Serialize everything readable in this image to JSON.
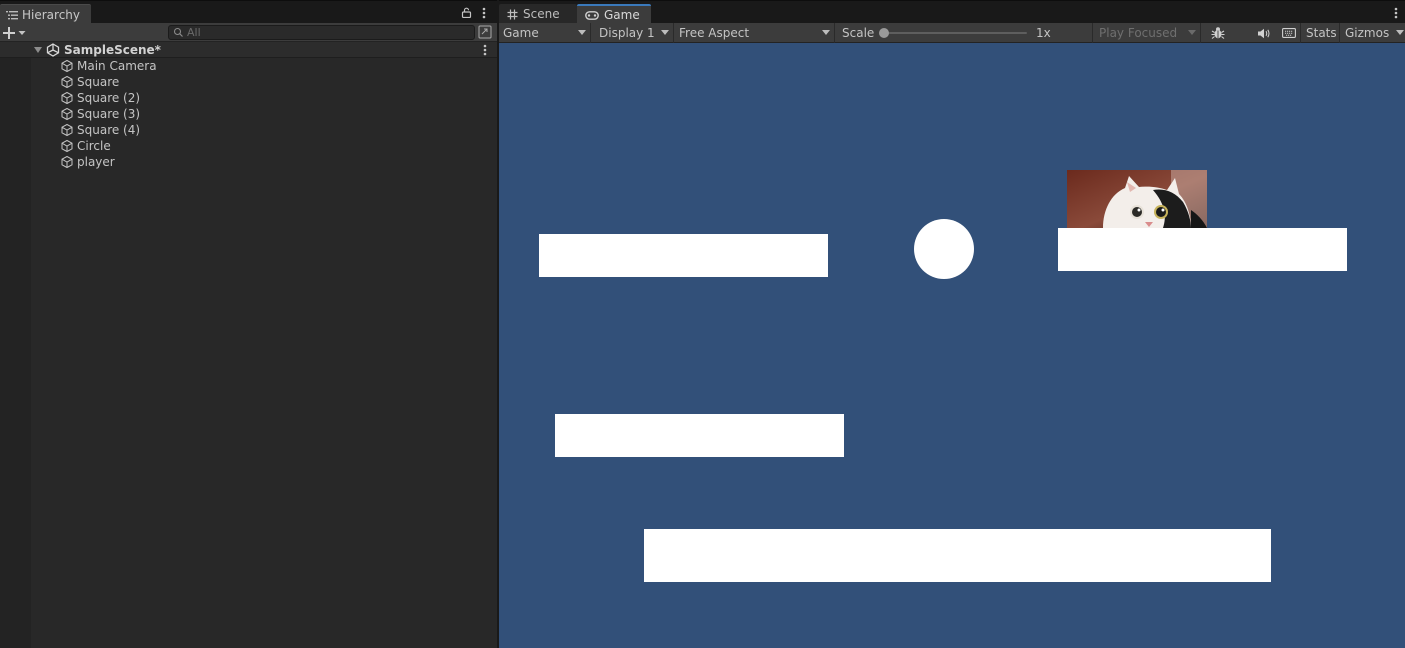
{
  "hierarchy": {
    "tab_label": "Hierarchy",
    "search_placeholder": "All",
    "scene_name": "SampleScene*",
    "items": [
      "Main Camera",
      "Square",
      "Square (2)",
      "Square (3)",
      "Square (4)",
      "Circle",
      "player"
    ]
  },
  "game_view": {
    "tabs": [
      "Scene",
      "Game"
    ],
    "active_tab": "Game",
    "toolbar": {
      "mode": "Game",
      "display": "Display 1",
      "aspect": "Free Aspect",
      "scale_label": "Scale",
      "scale_value": "1x",
      "play_mode": "Play Focused",
      "stats": "Stats",
      "gizmos": "Gizmos"
    },
    "background_color": "#325079",
    "object_color": "#ffffff",
    "player_sprite": "cat-photo"
  }
}
